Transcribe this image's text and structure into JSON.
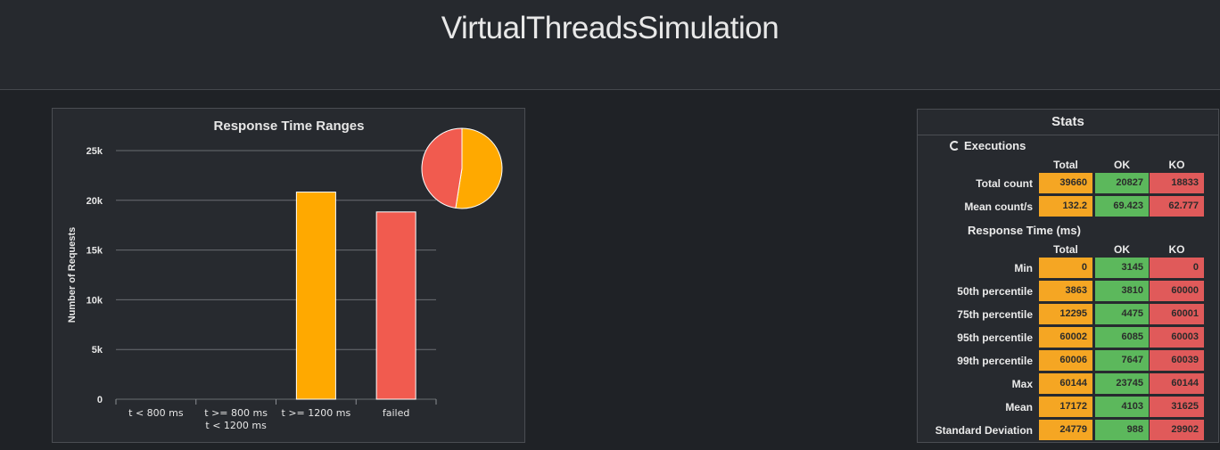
{
  "page": {
    "title": "VirtualThreadsSimulation"
  },
  "chart_data": {
    "type": "bar",
    "title": "Response Time Ranges",
    "ylabel": "Number of Requests",
    "xlabel": "",
    "categories": [
      "t < 800 ms",
      "t >= 800 ms\nt < 1200 ms",
      "t >= 1200 ms",
      "failed"
    ],
    "values": [
      0,
      0,
      20827,
      18833
    ],
    "colors": [
      "#f5a623",
      "#f5a623",
      "#ffa900",
      "#f15b4f"
    ],
    "ylim": [
      0,
      25000
    ],
    "yticks": [
      0,
      5000,
      10000,
      15000,
      20000,
      25000
    ],
    "ytick_labels": [
      "0",
      "5k",
      "10k",
      "15k",
      "20k",
      "25k"
    ],
    "grid": true,
    "pie": {
      "slices": [
        {
          "name": "OK",
          "value": 20827,
          "color": "#ffa900"
        },
        {
          "name": "KO",
          "value": 18833,
          "color": "#f15b4f"
        }
      ],
      "placement": "top-right"
    }
  },
  "stats": {
    "title": "Stats",
    "executions_title": "Executions",
    "response_title": "Response Time (ms)",
    "columns": [
      "Total",
      "OK",
      "KO"
    ],
    "executions": [
      {
        "label": "Total count",
        "total": "39660",
        "ok": "20827",
        "ko": "18833"
      },
      {
        "label": "Mean count/s",
        "total": "132.2",
        "ok": "69.423",
        "ko": "62.777"
      }
    ],
    "response": [
      {
        "label": "Min",
        "total": "0",
        "ok": "3145",
        "ko": "0"
      },
      {
        "label": "50th percentile",
        "total": "3863",
        "ok": "3810",
        "ko": "60000"
      },
      {
        "label": "75th percentile",
        "total": "12295",
        "ok": "4475",
        "ko": "60001"
      },
      {
        "label": "95th percentile",
        "total": "60002",
        "ok": "6085",
        "ko": "60003"
      },
      {
        "label": "99th percentile",
        "total": "60006",
        "ok": "7647",
        "ko": "60039"
      },
      {
        "label": "Max",
        "total": "60144",
        "ok": "23745",
        "ko": "60144"
      },
      {
        "label": "Mean",
        "total": "17172",
        "ok": "4103",
        "ko": "31625"
      },
      {
        "label": "Standard Deviation",
        "total": "24779",
        "ok": "988",
        "ko": "29902"
      }
    ],
    "colors": {
      "total": "#f5a623",
      "ok": "#5cb85c",
      "ko": "#e05a5a"
    }
  }
}
